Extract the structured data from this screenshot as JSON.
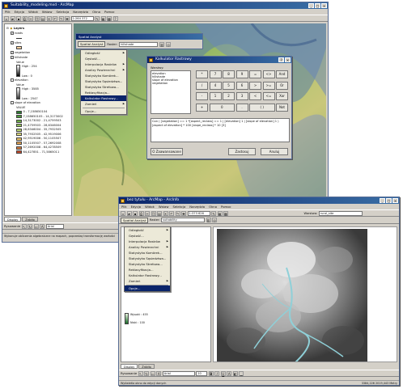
{
  "window1": {
    "title": "Suitability_modeling.mxd - ArcMap",
    "menu": [
      "Plik",
      "Edycja",
      "Widok",
      "Wstaw",
      "Selekcja",
      "Narzędzia",
      "Okno",
      "Pomoc"
    ],
    "scale": "1:264 372",
    "toc": {
      "root": "Layers",
      "layers": [
        {
          "name": "roads",
          "checked": true
        },
        {
          "name": "sites",
          "checked": true
        },
        {
          "name": "vegetation",
          "checked": true
        },
        {
          "name": "hillshade",
          "checked": true
        }
      ],
      "hillshade_value": "Value",
      "hillshade_high": "High : 254",
      "hillshade_low": "Low : 0",
      "elevation_label": "elevation",
      "elevation_value": "Value",
      "elevation_high": "High : 3585",
      "elevation_low": "Low : 2547",
      "slope_layer": "slope of elevation",
      "slope_field": "VALUE",
      "slope_classes": [
        {
          "label": "0 - 7,158650104",
          "color": "#2e7d32"
        },
        {
          "label": "7,158650105 - 14,3173002",
          "color": "#4e9a3c"
        },
        {
          "label": "14,3173002 - 21,4759503",
          "color": "#6fae47"
        },
        {
          "label": "21,4759503 - 28,6346004",
          "color": "#93c25a"
        },
        {
          "label": "28,6346004 - 35,7932505",
          "color": "#b9d46c"
        },
        {
          "label": "35,7932505 - 42,9519006",
          "color": "#dcd87a"
        },
        {
          "label": "42,9519006 - 50,1105507",
          "color": "#e9c468"
        },
        {
          "label": "50,1105507 - 57,2692008",
          "color": "#e0a050"
        },
        {
          "label": "57,2692008 - 64,4278509",
          "color": "#d27a3c"
        },
        {
          "label": "64,427851 - 71,5865011",
          "color": "#c24a2a"
        }
      ]
    },
    "tabs": [
      "Display",
      "Źródło"
    ],
    "drawing_label": "Rysowanie",
    "font_name": "Arial",
    "status": "Wykonuje obliczenia algebraiczne na mapach, poprzedzą transformację wartości"
  },
  "spatial_analyst": {
    "title": "Spatial Analyst",
    "menu_label": "Spatial Analyst",
    "layer_label": "Raster:",
    "layer_value": "hillshade",
    "items": [
      {
        "label": "Odległość",
        "arrow": true
      },
      {
        "label": "Gęstość...",
        "arrow": false
      },
      {
        "label": "Interpolacja Rastrów",
        "arrow": true
      },
      {
        "label": "Analizy Powierzchni",
        "arrow": true
      },
      {
        "label": "Statystyka Komórek...",
        "arrow": false
      },
      {
        "label": "Statystyka Sąsiedztwa...",
        "arrow": false
      },
      {
        "label": "Statystyka Strefowa...",
        "arrow": false
      },
      {
        "label": "Reklasyfikacja...",
        "arrow": false
      },
      {
        "label": "Kalkulator Rastrowy...",
        "arrow": false,
        "selected": true
      },
      {
        "label": "Zamień",
        "arrow": true
      },
      {
        "label": "Opcje...",
        "arrow": false
      }
    ]
  },
  "raster_calc": {
    "title": "Kalkulator Rastrowy",
    "layers_label": "Warstwy:",
    "layers": [
      "elevation",
      "hillshade",
      "slope of elevation",
      "vegetation"
    ],
    "numpad": [
      [
        "*",
        "7",
        "8",
        "9",
        "=",
        "<>",
        "And"
      ],
      [
        "/",
        "4",
        "5",
        "6",
        ">",
        ">=",
        "Or"
      ],
      [
        "-",
        "1",
        "2",
        "3",
        "<",
        "<=",
        "Xor"
      ],
      [
        "+",
        "0",
        ".",
        "( )",
        "Not"
      ]
    ],
    "expression": "Con ( [vegetation] == 1 *[aspect_reclass] == 1 | [elevation] 1 | [slope of elevation] 1 ) [aspect of elevation] * 100 [slope_reclass] * 10 [3]",
    "btn_advanced": "O Zaawansowane",
    "btn_eval": "Zastosuj",
    "btn_cancel": "Anuluj"
  },
  "window2": {
    "title": "bez tytułu - ArcMap - ArcInfo",
    "menu": [
      "Plik",
      "Edycja",
      "Widok",
      "Wstaw",
      "Selekcja",
      "Narzędzia",
      "Okno",
      "Pomoc"
    ],
    "scale": "1:373 626",
    "layer_combo": "Warstwa:",
    "layer_value": "rural_site",
    "spatial_label": "Spatial Analyst",
    "raster_label": "Raster:",
    "raster_value": "suitability",
    "items": [
      {
        "label": "Odległość",
        "arrow": true
      },
      {
        "label": "Gęstość...",
        "arrow": false
      },
      {
        "label": "Interpolacja Rastrów",
        "arrow": true
      },
      {
        "label": "Analizy Powierzchni",
        "arrow": true
      },
      {
        "label": "Statystyka Komórek...",
        "arrow": false
      },
      {
        "label": "Statystyka Sąsiedztwa...",
        "arrow": false
      },
      {
        "label": "Statystyka Strefowa...",
        "arrow": false
      },
      {
        "label": "Reklasyfikacja...",
        "arrow": false
      },
      {
        "label": "Kalkulator Rastrowy...",
        "arrow": false
      },
      {
        "label": "Zamień",
        "arrow": true
      },
      {
        "label": "Opcje...",
        "arrow": false,
        "selected": true
      }
    ],
    "legend_high": "Wysoki : 455",
    "legend_low": "Niski : 100",
    "tabs": [
      "Display",
      "Źródło"
    ],
    "drawing_label": "Rysowanie",
    "font_name": "Arial",
    "font_size": "10",
    "coords": "3384,226  2019,443 Metry",
    "status": "Wyświetla okno do edycji danych"
  }
}
